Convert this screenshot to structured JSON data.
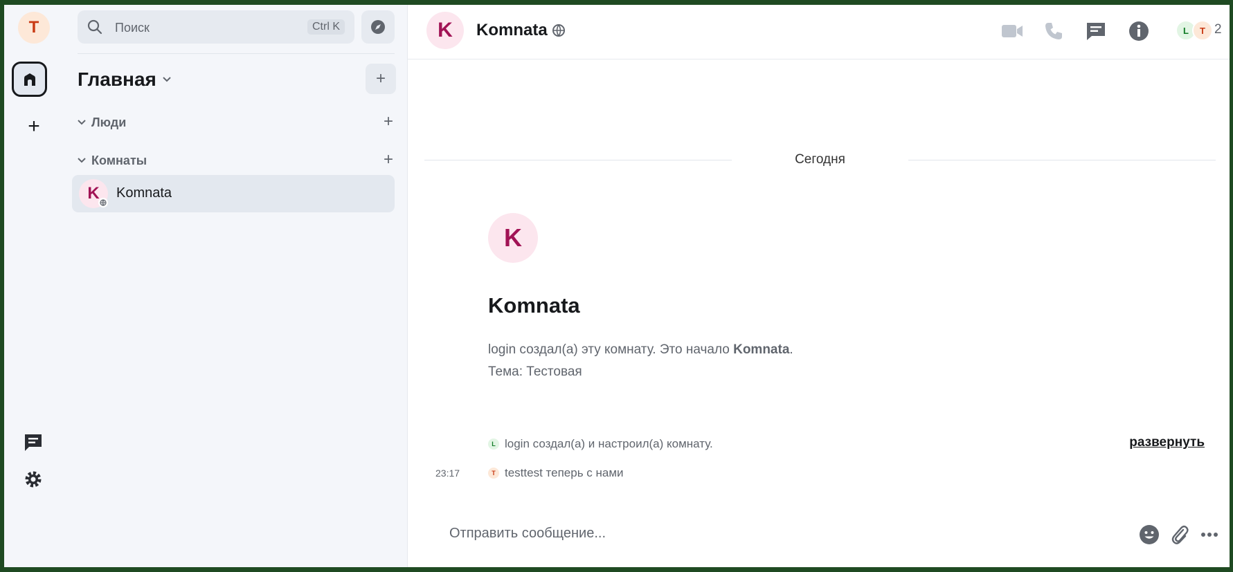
{
  "rail": {
    "user_initial": "T",
    "colors": {
      "user_avatar_bg": "#fde8d8",
      "user_avatar_fg": "#c93a14"
    }
  },
  "roomlist": {
    "search": {
      "placeholder": "Поиск",
      "shortcut": "Ctrl K"
    },
    "space_title": "Главная",
    "sections": [
      {
        "label": "Люди"
      },
      {
        "label": "Комнаты"
      }
    ],
    "rooms": [
      {
        "initial": "K",
        "name": "Komnata",
        "selected": true
      }
    ]
  },
  "header": {
    "room_initial": "K",
    "room_name": "Komnata",
    "icons": [
      "video-call-icon",
      "voice-call-icon",
      "threads-icon",
      "room-info-icon"
    ],
    "members": [
      {
        "initial": "L",
        "bg": "#e2f5e4",
        "fg": "#0f7a25"
      },
      {
        "initial": "T",
        "bg": "#fde8d8",
        "fg": "#c93a14"
      }
    ],
    "member_count": "2"
  },
  "timeline": {
    "date_separator": "Сегодня",
    "intro": {
      "initial": "K",
      "title": "Komnata",
      "created_prefix": "login создал(а) эту комнату. Это начало ",
      "created_room": "Komnata",
      "created_suffix": ".",
      "topic": "Тема: Тестовая"
    },
    "events": [
      {
        "avatar": "L",
        "text": "login создал(а) и настроил(а) комнату.",
        "action": "развернуть"
      },
      {
        "avatar": "T",
        "time": "23:17",
        "text": "testtest теперь с нами"
      }
    ]
  },
  "composer": {
    "placeholder": "Отправить сообщение..."
  }
}
